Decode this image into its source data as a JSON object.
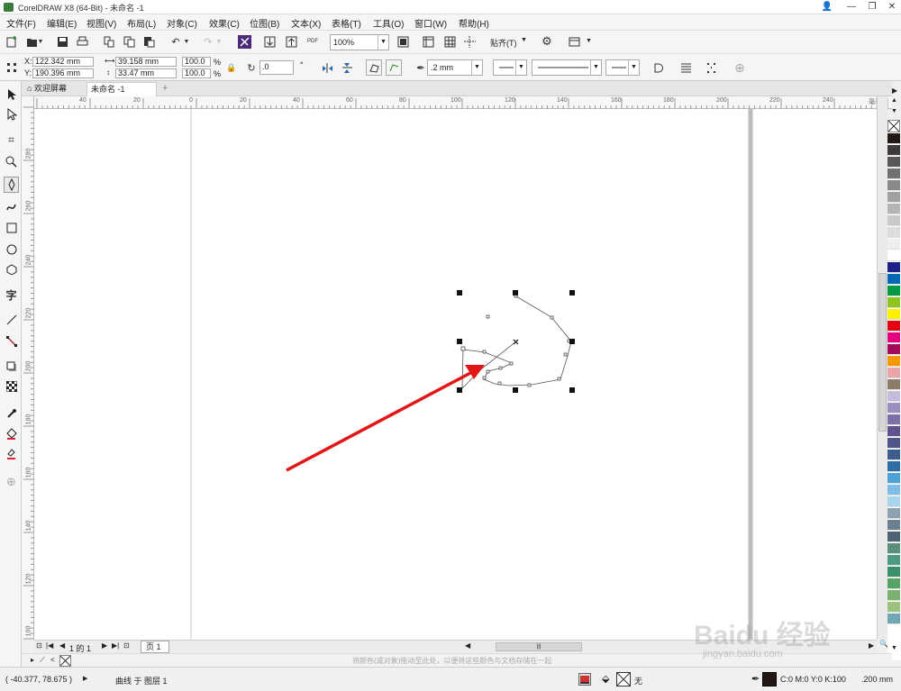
{
  "window": {
    "title": "CorelDRAW X8 (64-Bit) - 未命名 -1",
    "controls": [
      "👤",
      "—",
      "❐",
      "✕"
    ]
  },
  "menu": [
    "文件(F)",
    "编辑(E)",
    "视图(V)",
    "布局(L)",
    "对象(C)",
    "效果(C)",
    "位图(B)",
    "文本(X)",
    "表格(T)",
    "工具(O)",
    "窗口(W)",
    "帮助(H)"
  ],
  "toolbar": {
    "zoom": "100%",
    "snap_label": "贴齐(T)",
    "pdf_label": "PDF"
  },
  "property_bar": {
    "x_label": "X:",
    "x_value": "122.342 mm",
    "y_label": "Y:",
    "y_value": "190.396 mm",
    "width": "39.158 mm",
    "height": "33.47 mm",
    "scale_x": "100.0",
    "scale_y": "100.0",
    "percent": "%",
    "rotation": ".0",
    "outline_width": ".2 mm"
  },
  "tabs": {
    "welcome": "欢迎屏幕",
    "document": "未命名 -1",
    "add": "+"
  },
  "rulers": {
    "h_ticks": [
      "40",
      "20",
      "0",
      "20",
      "40",
      "60",
      "80",
      "100",
      "120",
      "140",
      "160",
      "180",
      "200",
      "220",
      "240"
    ],
    "h_unit": "毫米",
    "v_ticks": [
      "280",
      "260",
      "240",
      "220",
      "200",
      "180",
      "160",
      "140",
      "120",
      "100"
    ]
  },
  "page_nav": {
    "page_info": "1 的 1",
    "page_tab": "页 1"
  },
  "hint_text": "将颜色(或对象)拖动至此处，以便将这些颜色与文档存储在一起",
  "status": {
    "coords": "( -40.377, 78.675 )",
    "object_info": "曲线 于 图层 1",
    "fill_none": "无",
    "outline_color": "C:0 M:0 Y:0 K:100",
    "outline_width": ".200 mm"
  },
  "watermark": {
    "line1": "Baidu 经验",
    "line2": "jingyan.baidu.com"
  },
  "palette_colors": [
    "#231815",
    "#3e3a39",
    "#595757",
    "#727171",
    "#898989",
    "#9fa0a0",
    "#b5b5b6",
    "#c9caca",
    "#dcdddd",
    "#efefef",
    "#ffffff",
    "#1d2088",
    "#0068b7",
    "#009944",
    "#8fc31f",
    "#fff100",
    "#e60012",
    "#e4007f",
    "#a40b5d",
    "#f39800",
    "#eaa4a9",
    "#8c7a6b",
    "#c4bcd9",
    "#9b8fc2",
    "#7d6fa8",
    "#5f528c",
    "#4e5688",
    "#3c5c8e",
    "#2e6da4",
    "#4da1d9",
    "#7dbde6",
    "#a9d5ef",
    "#8fa0b0",
    "#6b7f8f",
    "#4f6372",
    "#5a8f7b",
    "#4c9a82",
    "#3b8f6a",
    "#57a364",
    "#79b26c",
    "#9cc27d",
    "#6fa8b4"
  ]
}
